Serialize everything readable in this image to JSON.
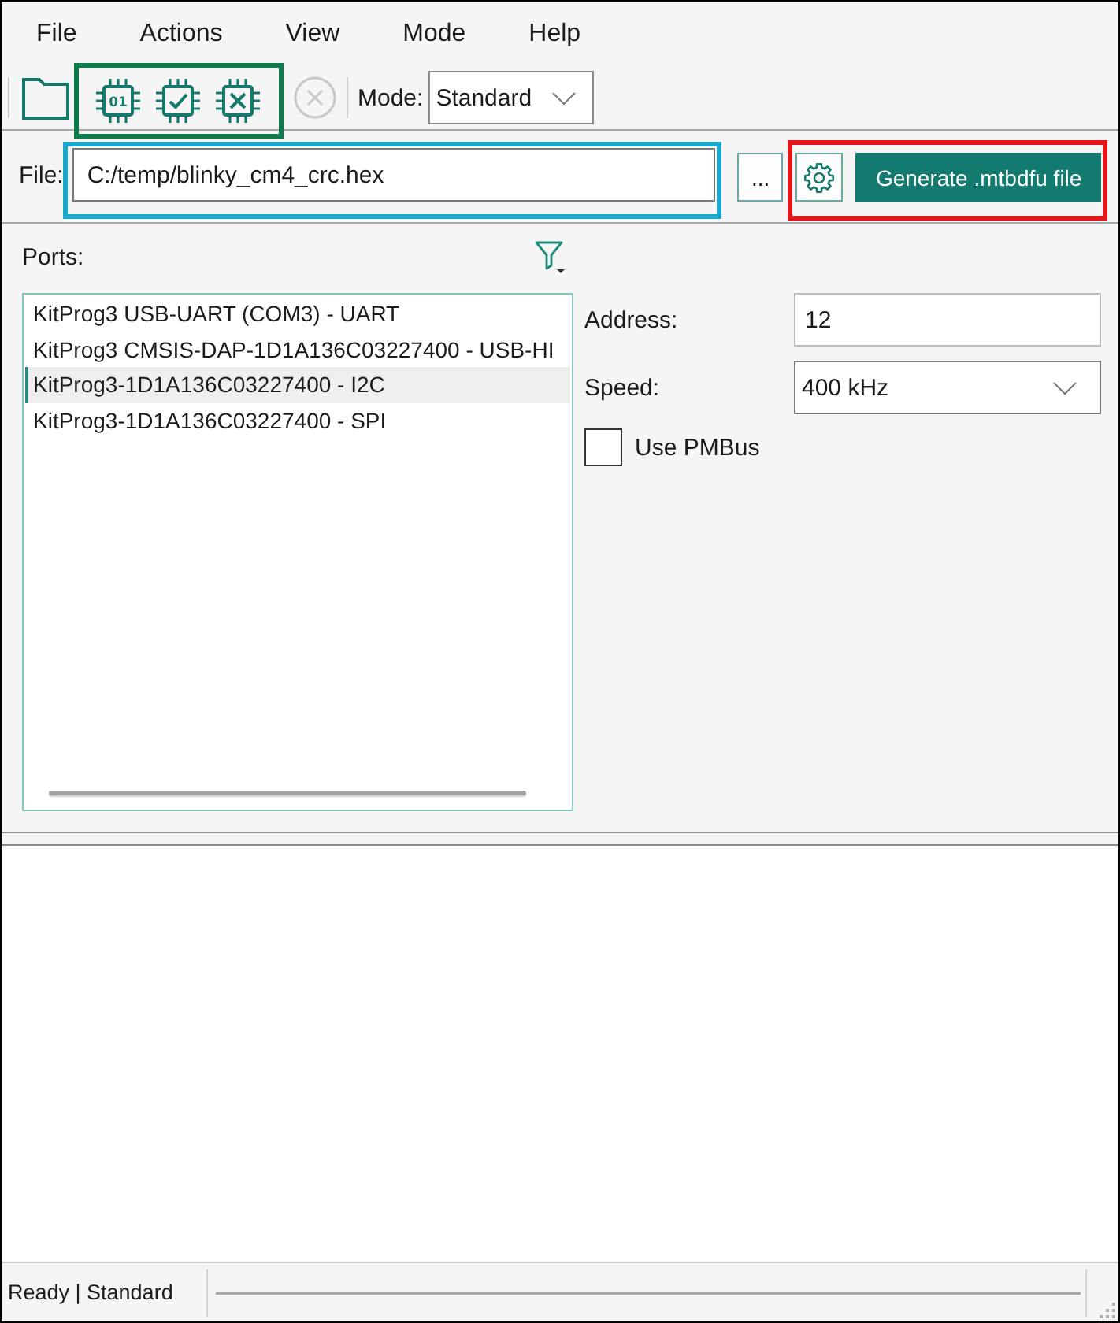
{
  "menu": [
    "File",
    "Actions",
    "View",
    "Mode",
    "Help"
  ],
  "toolbar": {
    "groups": [
      {
        "highlighted": false,
        "buttons": [
          {
            "kind": "open",
            "disabled": false
          }
        ]
      },
      {
        "highlighted": true,
        "buttons": [
          {
            "kind": "program",
            "icon_text": "01",
            "disabled": false
          },
          {
            "kind": "verify",
            "disabled": false
          },
          {
            "kind": "erase",
            "disabled": false
          }
        ]
      },
      {
        "highlighted": false,
        "buttons": [
          {
            "kind": "stop",
            "disabled": true
          }
        ]
      }
    ],
    "mode": {
      "label": "Mode:",
      "value": "Standard"
    }
  },
  "file_bar": {
    "label": "File:",
    "path": {
      "value": "C:/temp/blinky_cm4_crc.hex",
      "highlighted": true
    },
    "browse_button": "...",
    "actions": {
      "highlighted": true,
      "generate_button": "Generate .mtbdfu file"
    }
  },
  "ports": {
    "label": "Ports:",
    "items": [
      {
        "label": "KitProg3 USB-UART (COM3) - UART",
        "selected": false
      },
      {
        "label": "KitProg3 CMSIS-DAP-1D1A136C03227400 - USB-HI",
        "selected": false
      },
      {
        "label": "KitProg3-1D1A136C03227400 - I2C",
        "selected": true
      },
      {
        "label": "KitProg3-1D1A136C03227400 - SPI",
        "selected": false
      }
    ]
  },
  "connection": {
    "address": {
      "label": "Address:",
      "value": "12"
    },
    "speed": {
      "label": "Speed:",
      "value": "400 kHz"
    },
    "use_pmbus": {
      "label": "Use PMBus",
      "checked": false
    }
  },
  "status_bar": {
    "text": "Ready | Standard"
  }
}
